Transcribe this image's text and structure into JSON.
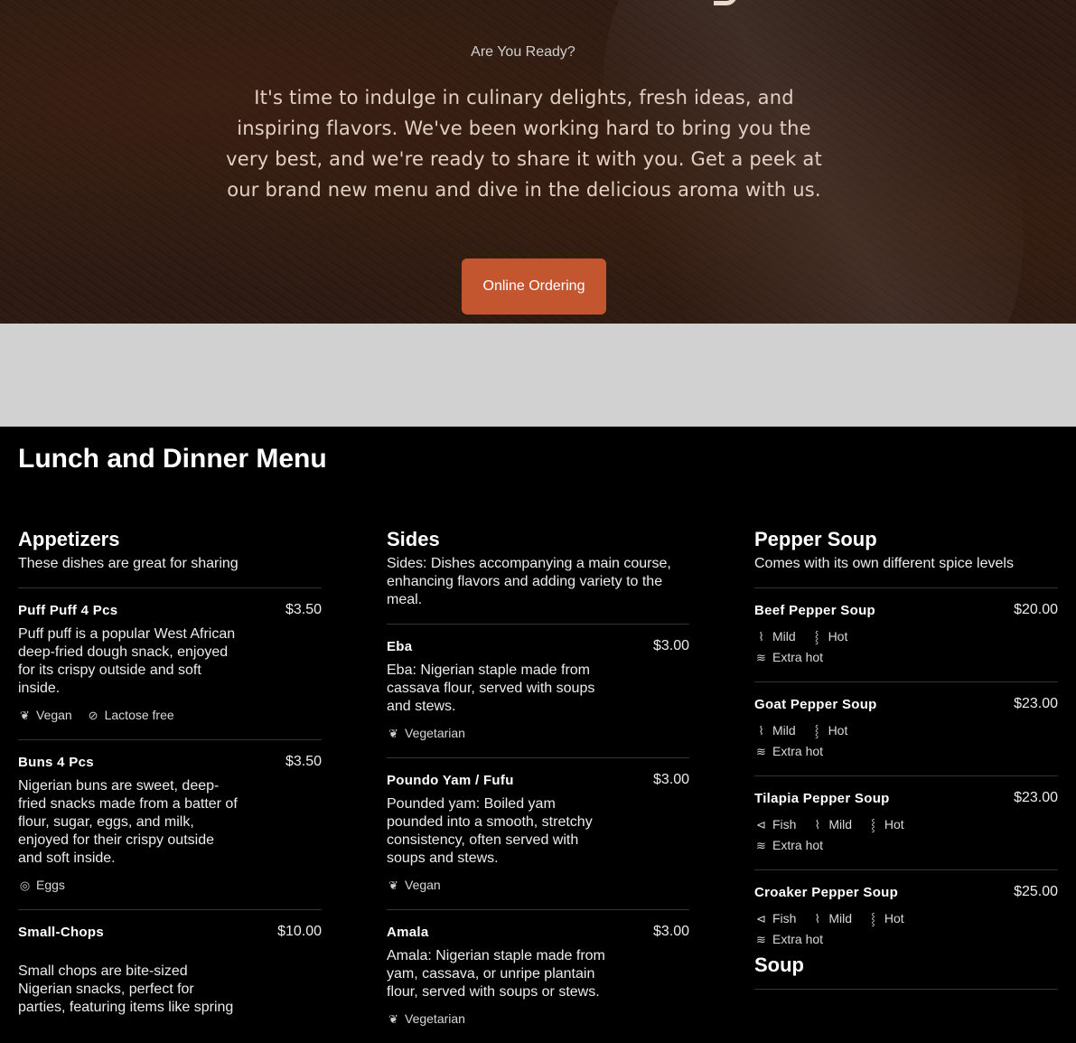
{
  "hero": {
    "eyebrow": "Are You Ready?",
    "lead": "It's time to indulge in culinary delights, fresh ideas, and inspiring flavors. We've been working hard to bring you the very best, and we're ready to share it with you. Get a peek at our brand new menu and dive in the delicious aroma with us.",
    "button_label": "Online Ordering"
  },
  "menu": {
    "title": "Lunch and Dinner Menu",
    "appetizers": {
      "title": "Appetizers",
      "desc": "These dishes are great for sharing",
      "items": [
        {
          "name": "Puff Puff 4 Pcs",
          "price": "$3.50",
          "desc": "Puff puff is a popular West African deep-fried dough snack, enjoyed for its crispy outside and soft inside.",
          "tags": [
            "Vegan",
            "Lactose free"
          ]
        },
        {
          "name": "Buns 4 Pcs",
          "price": "$3.50",
          "desc": "Nigerian buns are sweet, deep-fried snacks made from a batter of flour, sugar, eggs, and milk, enjoyed for their crispy outside and soft inside.",
          "tags": [
            "Eggs"
          ]
        },
        {
          "name": "Small-Chops",
          "price": "$10.00",
          "desc": "Small chops are bite-sized Nigerian snacks, perfect for parties, featuring items like spring"
        }
      ]
    },
    "sides": {
      "title": "Sides",
      "desc": "Sides: Dishes accompanying a main course, enhancing flavors and adding variety to the meal.",
      "items": [
        {
          "name": "Eba",
          "price": "$3.00",
          "desc": "Eba: Nigerian staple made from cassava flour, served with soups and stews.",
          "tags": [
            "Vegetarian"
          ]
        },
        {
          "name": "Poundo Yam / Fufu",
          "price": "$3.00",
          "desc": "Pounded yam: Boiled yam pounded into a smooth, stretchy consistency, often served with soups and stews.",
          "tags": [
            "Vegan"
          ]
        },
        {
          "name": "Amala",
          "price": "$3.00",
          "desc": "Amala: Nigerian staple made from yam, cassava, or unripe plantain flour, served with soups or stews.",
          "tags": [
            "Vegetarian"
          ]
        }
      ]
    },
    "pepper_soup": {
      "title": "Pepper Soup",
      "desc": "Comes with its own different spice levels",
      "items": [
        {
          "name": "Beef Pepper Soup",
          "price": "$20.00",
          "tags": [
            "Mild",
            "Hot",
            "Extra hot"
          ]
        },
        {
          "name": "Goat Pepper Soup",
          "price": "$23.00",
          "tags": [
            "Mild",
            "Hot",
            "Extra hot"
          ]
        },
        {
          "name": "Tilapia Pepper Soup",
          "price": "$23.00",
          "tags": [
            "Fish",
            "Mild",
            "Hot",
            "Extra hot"
          ]
        },
        {
          "name": "Croaker Pepper Soup",
          "price": "$25.00",
          "tags": [
            "Fish",
            "Mild",
            "Hot",
            "Extra hot"
          ]
        }
      ]
    },
    "soup": {
      "title": "Soup"
    }
  },
  "icons": {
    "vegan": "leaf-icon",
    "vegetarian": "leaf-icon",
    "lactose_free": "no-milk-icon",
    "eggs": "egg-icon",
    "mild": "chili-icon",
    "hot": "chili-double-icon",
    "extra_hot": "chili-triple-icon",
    "fish": "fish-icon"
  },
  "colors": {
    "accent": "#c3562f",
    "background": "#000000",
    "band": "#d1d1d1"
  }
}
